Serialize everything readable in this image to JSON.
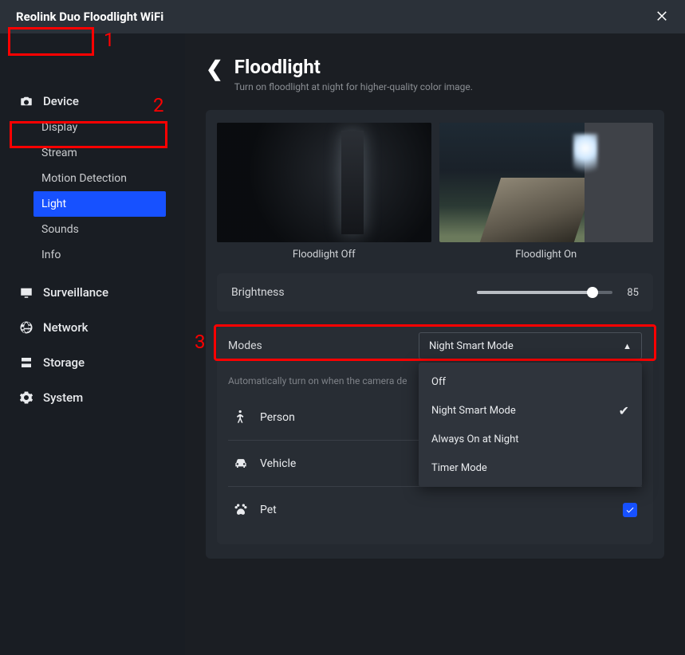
{
  "titlebar": {
    "title": "Reolink Duo Floodlight WiFi"
  },
  "annotations": {
    "n1": "1",
    "n2": "2",
    "n3": "3"
  },
  "sidebar": {
    "device": "Device",
    "device_items": [
      "Display",
      "Stream",
      "Motion Detection",
      "Light",
      "Sounds",
      "Info"
    ],
    "surveillance": "Surveillance",
    "network": "Network",
    "storage": "Storage",
    "system": "System"
  },
  "page": {
    "title": "Floodlight",
    "subtitle": "Turn on floodlight at night for higher-quality color image."
  },
  "previews": {
    "off_label": "Floodlight Off",
    "on_label": "Floodlight On"
  },
  "brightness": {
    "label": "Brightness",
    "value": "85",
    "percent": 85
  },
  "modes": {
    "label": "Modes",
    "selected": "Night Smart Mode",
    "helper": "Automatically turn on when the camera de",
    "options": [
      "Off",
      "Night Smart Mode",
      "Always On at Night",
      "Timer Mode"
    ]
  },
  "detect": {
    "rows": [
      {
        "icon": "person",
        "label": "Person",
        "checked": false
      },
      {
        "icon": "vehicle",
        "label": "Vehicle",
        "checked": false
      },
      {
        "icon": "pet",
        "label": "Pet",
        "checked": true
      }
    ]
  }
}
